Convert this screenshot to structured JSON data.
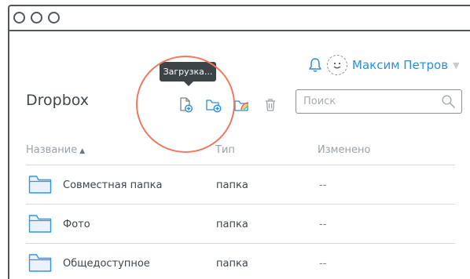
{
  "window": {
    "controls": [
      "window-dot",
      "window-dot",
      "window-dot"
    ]
  },
  "user": {
    "name": "Максим Петров",
    "icons": [
      "bell-icon",
      "avatar-smiley-icon",
      "caret-down-icon"
    ]
  },
  "tooltip": {
    "text": "Загрузка..."
  },
  "header": {
    "title": "Dropbox"
  },
  "toolbar": {
    "icons": [
      "upload-file-icon",
      "new-folder-icon",
      "photo-folder-icon",
      "trash-icon"
    ]
  },
  "search": {
    "placeholder": "Поиск",
    "value": ""
  },
  "table": {
    "columns": {
      "name": "Название",
      "type": "Тип",
      "modified": "Изменено"
    },
    "sort_indicator": "▲",
    "rows": [
      {
        "name": "Совместная папка",
        "type": "папка",
        "modified": "--",
        "icon": "folder-icon"
      },
      {
        "name": "Фото",
        "type": "папка",
        "modified": "--",
        "icon": "folder-icon"
      },
      {
        "name": "Общедоступное",
        "type": "папка",
        "modified": "--",
        "icon": "folder-icon"
      }
    ]
  },
  "colors": {
    "accent": "#2a8ed9",
    "highlight": "#ee7a5f",
    "text": "#3d464d",
    "muted": "#9aa1a7",
    "folder": "#2e97e6",
    "folder_fill": "#eaf3fb"
  }
}
